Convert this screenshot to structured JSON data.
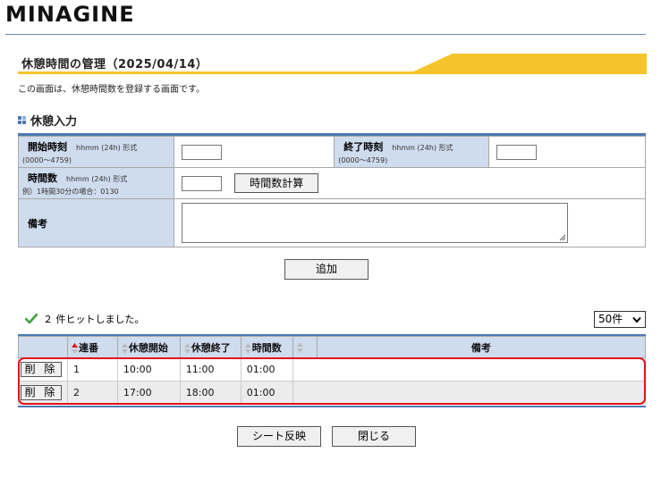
{
  "brand": "MINAGINE",
  "page": {
    "title": "休憩時間の管理（2025/04/14）",
    "description": "この画面は、休憩時間数を登録する画面です。",
    "section_title": "休憩入力"
  },
  "form": {
    "start": {
      "label": "開始時刻",
      "format": "hhmm (24h) 形式",
      "range": "(0000～4759)",
      "value": ""
    },
    "end": {
      "label": "終了時刻",
      "format": "hhmm (24h) 形式",
      "range": "(0000～4759)",
      "value": ""
    },
    "hours": {
      "label": "時間数",
      "format": "hhmm (24h) 形式",
      "example": "例）1時間30分の場合：0130",
      "value": "",
      "calc_button": "時間数計算"
    },
    "remarks": {
      "label": "備考",
      "value": ""
    },
    "add_button": "追加"
  },
  "results": {
    "hit_text": "２ 件ヒットしました。",
    "page_size": "50件",
    "columns": [
      "連番",
      "休憩開始",
      "休憩終了",
      "時間数",
      "",
      "備考"
    ],
    "rows": [
      {
        "delete": "削 除",
        "no": "1",
        "start": "10:00",
        "end": "11:00",
        "hours": "01:00",
        "remarks": ""
      },
      {
        "delete": "削 除",
        "no": "2",
        "start": "17:00",
        "end": "18:00",
        "hours": "01:00",
        "remarks": ""
      }
    ]
  },
  "footer": {
    "sheet_button": "シート反映",
    "close_button": "閉じる"
  },
  "colors": {
    "accent_blue": "#4b79b4",
    "label_bg": "#cfdcee",
    "title_yellow": "#f5c42a",
    "highlight_red": "#e0141c",
    "check_green": "#3fa33a"
  }
}
